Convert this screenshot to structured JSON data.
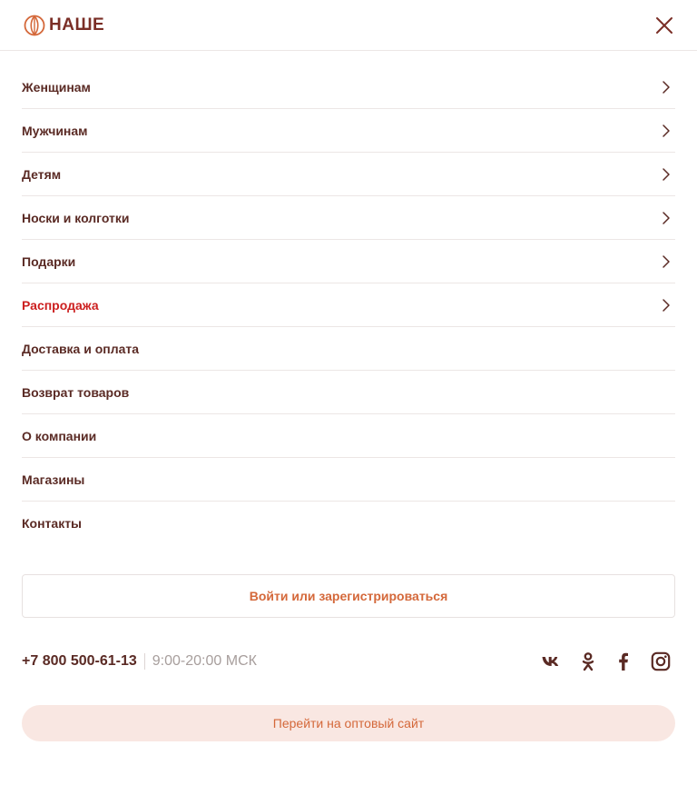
{
  "header": {
    "logo_text": "НАШЕ",
    "logo_icon": "sunflower-logo-icon",
    "close_icon": "close-icon"
  },
  "menu": {
    "items": [
      {
        "label": "Женщинам",
        "has_submenu": true
      },
      {
        "label": "Мужчинам",
        "has_submenu": true
      },
      {
        "label": "Детям",
        "has_submenu": true
      },
      {
        "label": "Носки и колготки",
        "has_submenu": true
      },
      {
        "label": "Подарки",
        "has_submenu": true
      },
      {
        "label": "Распродажа",
        "has_submenu": true,
        "highlight": true
      },
      {
        "label": "Доставка и оплата",
        "has_submenu": false
      },
      {
        "label": "Возврат товаров",
        "has_submenu": false
      },
      {
        "label": "О компании",
        "has_submenu": false
      },
      {
        "label": "Магазины",
        "has_submenu": false
      },
      {
        "label": "Контакты",
        "has_submenu": false
      }
    ]
  },
  "login": {
    "label": "Войти или зарегистрироваться"
  },
  "contact": {
    "phone": "+7 800 500-61-13",
    "hours": "9:00-20:00 МСК"
  },
  "social": [
    "vk-icon",
    "odnoklassniki-icon",
    "facebook-icon",
    "instagram-icon"
  ],
  "wholesale": {
    "label": "Перейти на оптовый сайт"
  },
  "colors": {
    "text": "#5a2a24",
    "sale": "#cc1f1f",
    "accent": "#d4683a",
    "wholesale_bg": "#f9e7e2",
    "divider": "#ece6e5"
  }
}
